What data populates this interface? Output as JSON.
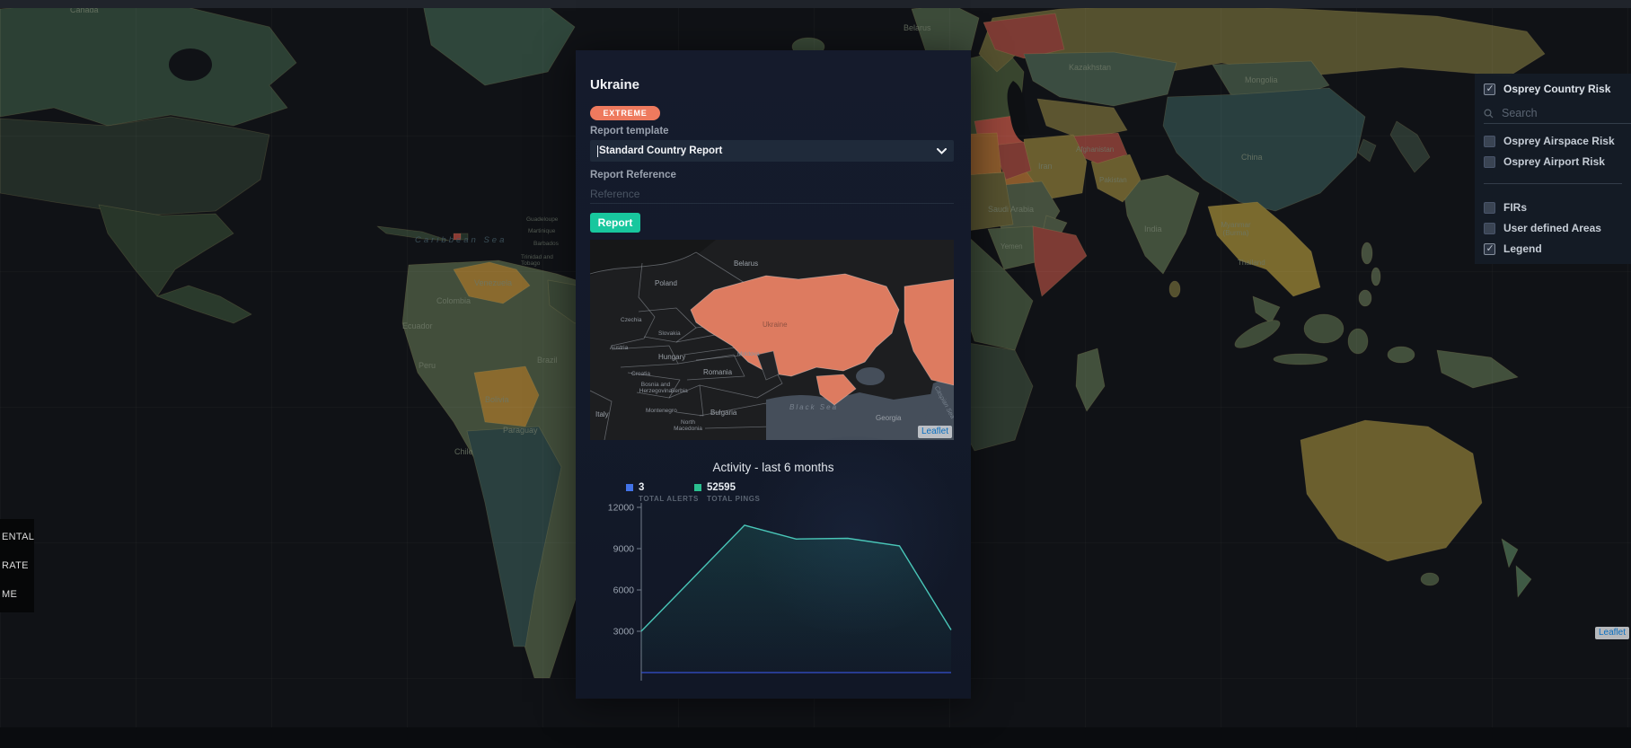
{
  "colors": {
    "extreme_badge": "#ee7a5e",
    "report_button": "#18c79e",
    "map_highlight": "#dd7b60"
  },
  "background_map": {
    "attribution": "Leaflet",
    "labels": [
      "Canada",
      "Caribbean Sea",
      "Guadeloupe",
      "Martinique",
      "Barbados",
      "Trinidad and Tobago",
      "Colombia",
      "Venezuela",
      "Ecuador",
      "Peru",
      "Brazil",
      "Bolivia",
      "Paraguay",
      "Chile",
      "Belarus",
      "Kazakhstan",
      "Mongolia",
      "China",
      "India",
      "Iran",
      "Afghanistan",
      "Pakistan",
      "Saudi Arabia",
      "Yemen",
      "Thailand",
      "Myanmar (Burma)"
    ]
  },
  "risk_scale": {
    "visible_items": [
      "ENTAL",
      "RATE",
      "ME"
    ]
  },
  "layers_panel": {
    "search_placeholder": "Search",
    "items": [
      {
        "label": "Osprey Country Risk",
        "checked": true
      },
      {
        "label": "Osprey Airspace Risk",
        "checked": false
      },
      {
        "label": "Osprey Airport Risk",
        "checked": false
      },
      {
        "label": "FIRs",
        "checked": false
      },
      {
        "label": "User defined Areas",
        "checked": false
      },
      {
        "label": "Legend",
        "checked": true
      }
    ]
  },
  "report_panel": {
    "title": "Ukraine",
    "risk_badge": "EXTREME",
    "template_label": "Report template",
    "template_value": "Standard Country Report",
    "reference_label": "Report Reference",
    "reference_placeholder": "Reference",
    "report_button": "Report",
    "minimap": {
      "attribution": "Leaflet",
      "labels": [
        "Belarus",
        "Poland",
        "Czechia",
        "Slovakia",
        "Austria",
        "Hungary",
        "Croatia",
        "Romania",
        "Moldova",
        "Ukraine",
        "Italy",
        "Bosnia and Herzegovina",
        "Serbia",
        "Montenegro",
        "Bulgaria",
        "North Macedonia",
        "Black Sea",
        "Georgia",
        "Caspian Sea"
      ]
    }
  },
  "chart_data": {
    "type": "line",
    "title": "Activity - last 6 months",
    "x_labels_shown": false,
    "series": [
      {
        "name": "TOTAL ALERTS",
        "total": "3",
        "swatch_color": "#4273e8",
        "line_color": "#3550cf",
        "values": [
          0,
          1,
          0,
          0,
          1,
          0,
          1
        ]
      },
      {
        "name": "TOTAL PINGS",
        "total": "52595",
        "swatch_color": "#2abf8f",
        "line_color": "#49c6b8",
        "values": [
          3000,
          6850,
          10700,
          9700,
          9750,
          9200,
          3100
        ]
      }
    ],
    "ylim": [
      0,
      12000
    ],
    "yticks": [
      3000,
      6000,
      9000,
      12000
    ],
    "grid": false,
    "legend_position": "top-left"
  }
}
